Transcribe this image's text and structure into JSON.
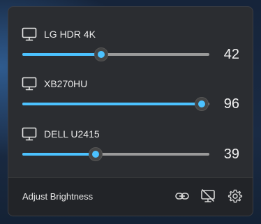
{
  "monitors": [
    {
      "name": "LG HDR 4K",
      "brightness": "42",
      "level": 42,
      "icon": "monitor-icon"
    },
    {
      "name": "XB270HU",
      "brightness": "96",
      "level": 96,
      "icon": "monitor-icon"
    },
    {
      "name": "DELL U2415",
      "brightness": "39",
      "level": 39,
      "icon": "monitor-icon"
    }
  ],
  "footer": {
    "label": "Adjust Brightness",
    "buttons": [
      "link-icon",
      "screen-off-icon",
      "gear-icon"
    ]
  },
  "colors": {
    "accent": "#4cc2ff",
    "track": "#9a9a9a",
    "panel": "#2b2d31",
    "footer": "#222428"
  }
}
